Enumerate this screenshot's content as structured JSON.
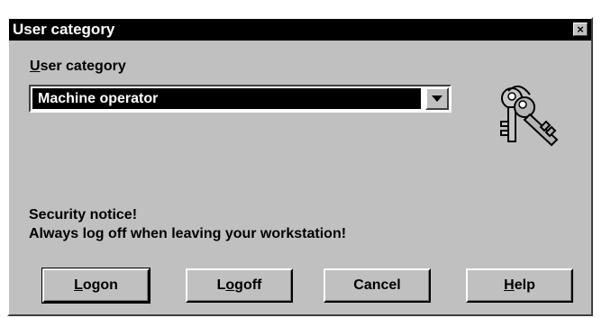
{
  "window": {
    "title": "User category",
    "close_symbol": "×"
  },
  "field": {
    "label_accel": "U",
    "label_rest": "ser category",
    "selected_value": "Machine operator"
  },
  "notice": {
    "line1": "Security notice!",
    "line2": "Always log off when leaving your workstation!"
  },
  "buttons": [
    {
      "accel": "L",
      "rest": "ogon"
    },
    {
      "pre": "L",
      "accel": "o",
      "rest": "goff"
    },
    {
      "label": "Cancel"
    },
    {
      "accel": "H",
      "rest": "elp"
    }
  ],
  "icons": {
    "keys": "keys-icon",
    "dropdown": "chevron-down-icon"
  },
  "colors": {
    "face": "#c0c0c0",
    "titlebar": "#000000",
    "selection": "#000000"
  }
}
